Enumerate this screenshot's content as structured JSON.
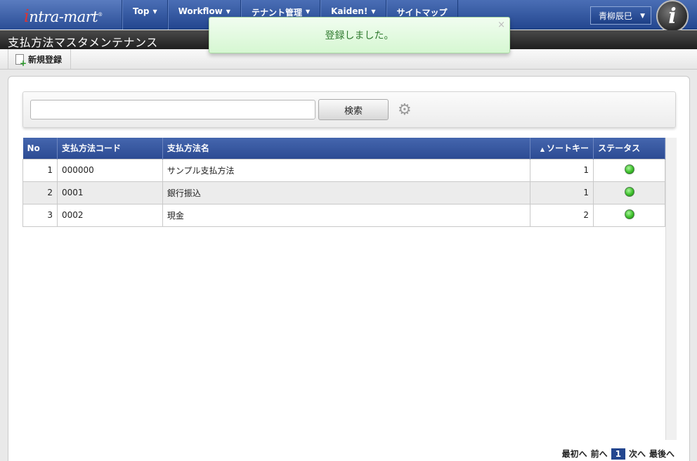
{
  "header": {
    "logo_text": "ntra-mart",
    "logo_mark": "i",
    "nav": [
      {
        "label": "Top"
      },
      {
        "label": "Workflow"
      },
      {
        "label": "テナント管理"
      },
      {
        "label": "Kaiden!"
      },
      {
        "label": "サイトマップ"
      }
    ],
    "user": "青柳辰巳"
  },
  "page_title": "支払方法マスタメンテナンス",
  "toolbar": {
    "new_label": "新規登録"
  },
  "search": {
    "value": "",
    "button_label": "検索"
  },
  "grid": {
    "columns": [
      "No",
      "支払方法コード",
      "支払方法名",
      "ソートキー",
      "ステータス"
    ],
    "rows": [
      {
        "no": "1",
        "code": "000000",
        "name": "サンプル支払方法",
        "sort": "1"
      },
      {
        "no": "2",
        "code": "0001",
        "name": "銀行振込",
        "sort": "1"
      },
      {
        "no": "3",
        "code": "0002",
        "name": "現金",
        "sort": "2"
      }
    ]
  },
  "pager": {
    "first": "最初へ",
    "prev": "前へ",
    "current": "1",
    "next": "次へ",
    "last": "最後へ"
  },
  "toast": {
    "message": "登録しました。",
    "close": "×"
  },
  "colors": {
    "nav": "#2c4b93",
    "status_ok": "#3cbf2a",
    "toast_text": "#2f7a2f"
  }
}
